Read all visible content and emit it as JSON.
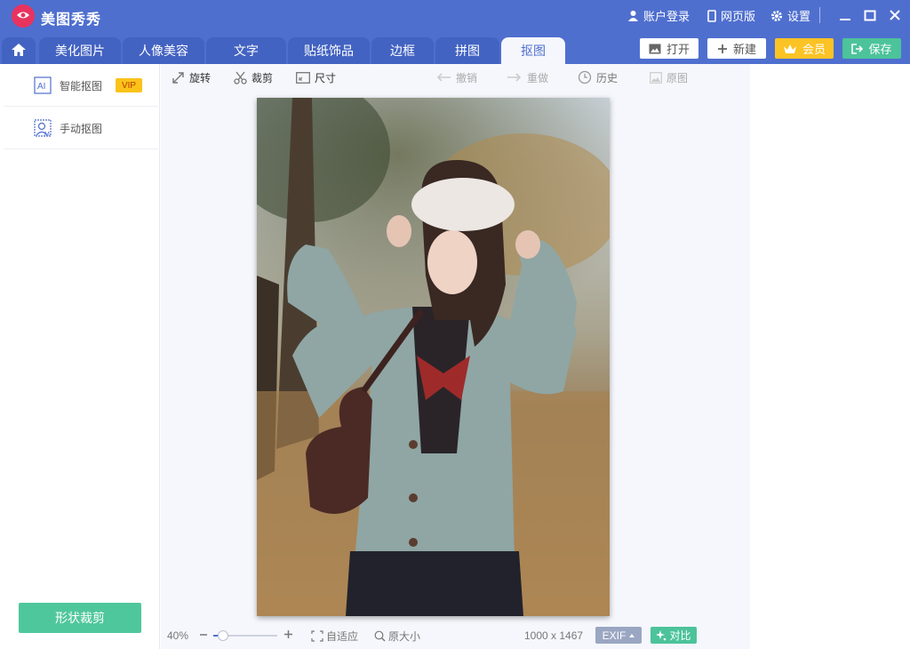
{
  "app": {
    "title": "美图秀秀"
  },
  "titlebar": {
    "login": "账户登录",
    "web": "网页版",
    "settings": "设置"
  },
  "tabs": [
    {
      "label": "美化图片"
    },
    {
      "label": "人像美容"
    },
    {
      "label": "文字"
    },
    {
      "label": "贴纸饰品"
    },
    {
      "label": "边框"
    },
    {
      "label": "拼图"
    },
    {
      "label": "抠图",
      "active": true
    }
  ],
  "actions": {
    "open": "打开",
    "new": "新建",
    "vip": "会员",
    "save": "保存"
  },
  "left_panel": {
    "items": [
      {
        "label": "智能抠图",
        "badge": "VIP",
        "icon_text": "AI"
      },
      {
        "label": "手动抠图"
      }
    ],
    "shape_crop": "形状裁剪"
  },
  "toolbar": {
    "rotate": "旋转",
    "crop": "裁剪",
    "size": "尺寸",
    "undo": "撤销",
    "redo": "重做",
    "history": "历史",
    "original": "原图"
  },
  "status": {
    "zoom": "40%",
    "fit": "自适应",
    "actual": "原大小",
    "dimensions": "1000 x 1467",
    "exif": "EXIF",
    "compare": "对比",
    "zoom_fraction": 0.14
  },
  "colors": {
    "titlebar": "#4f6fcf",
    "tab": "#4363c2",
    "accent_green": "#4cc39a",
    "vip_yellow": "#fcc324"
  }
}
